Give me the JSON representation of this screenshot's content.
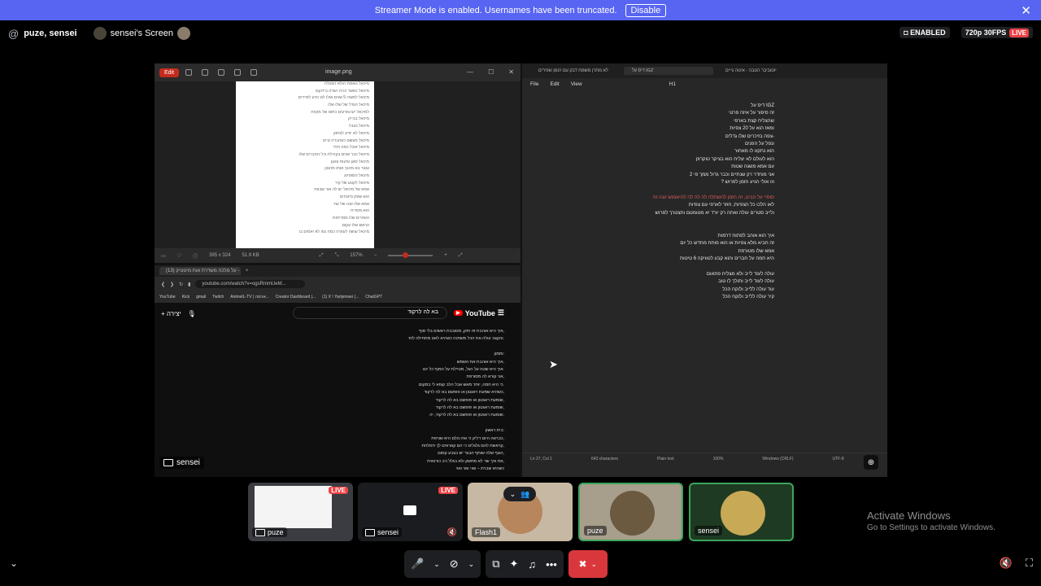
{
  "banner": {
    "message": "Streamer Mode is enabled. Usernames have been truncated.",
    "disable_label": "Disable",
    "close_glyph": "✕"
  },
  "topbar": {
    "users": "puze, sensei",
    "stream_title": "sensei's Screen",
    "enabled_label": "ENABLED",
    "quality_label": "720p 30FPS",
    "live_label": "LIVE"
  },
  "image_viewer": {
    "edit_label": "Edit",
    "file_name": "image.png",
    "footer_dims": "395 x 324",
    "footer_size": "51.9 KB",
    "zoom_level": "157%",
    "doc_lines": [
      "מיכאל נואמת הולא הוזגלדו",
      "מיכאל כאשר ככיה הגדה בידוקם",
      "מיכאל לפשרו 5 שנים אולו לא רגיע לפרדים",
      "מיכאל הגדל של שלו שלו",
      "למיכאל יש נפרעים כתוא של מקיוח",
      "מיכאל בבייק",
      "מיכאל נונבל",
      "מיכאל לא יודע לצחוק",
      "מיכאל מעשם כאהבדה טייט",
      "מיכאל אוכל כמה חזיר",
      "מיכאל כבר שנים בקהילה וכל החברים שלו",
      "מיכאל סוגן טיטות ונגען",
      "עטור בא מהנך אותו מהטון",
      "מיכאל המוסינג",
      "מיכאל לקטע של קיר",
      "אמא של מיכאל יש לה אור שבוות",
      "הוא שותן מיונתים",
      "אמא שלו זונה של עוד",
      "הוא מסריח",
      "השיניים שלו מסריחות",
      "הראש שלו עקום",
      "מיכאל עושה לעוזרה כמה נמו לא יאמים בו"
    ]
  },
  "browser": {
    "tab_title": "(13) על מלכה משדרת אות מיטטיק -",
    "url": "youtube.com/watch?v=ogsRmmUeM...",
    "bookmarks": [
      "YouTube",
      "Kick",
      "gmail",
      "Twitch",
      "AnimeIL-TV | אנימה...",
      "Creator Dashboard |...",
      "(1) X \\ Yarijemsei (...",
      "ChatGPT"
    ],
    "search_query": "בא לה לרקוד",
    "yt_brand": "YouTube",
    "create_label": "יצירה",
    "lyrics": [
      "איך היא אוהבת זה חזק, מסובבת ראשים בלי סוף,",
      "והקצב עולה את הכל משתנה כשהיא לאט מתחילה לזוז.",
      "",
      "פזמון:",
      "איך היא אוהבת את השמש,",
      "איך היא שטה על הגל, מטיילת על המוף כל יום.",
      "אני קורא לה מסורפת,",
      "כי היא חמה, יותר מאש אבל הלב קופא לי במקום.",
      "כשהיא שמעת ראגטון או פופשם בא לה לרקוד,",
      "שומעת ראגטון או פופשם בא לה לרקוד,",
      "שומעת ראגטון או פופשם בא לה לרקוד,",
      "שומעת ראגטון או פופשם בא לה לרקוד, יה.",
      "",
      "בית ראשון:",
      "כבראה היום דליק כי את כולם היא שורפת,",
      "קראשת להם גלגלים כי הם קאראים לך תפלחת,",
      "הגוף שלה שותף הבגד יש בצבע קסום,",
      "את איך שר לא מתשק ולא בגלל ניב כורנאית,",
      "כשהיא שברת – ואוי ואוי ואוי"
    ]
  },
  "notepad": {
    "tabs": [
      "לא מתרן משמח דבק עם הומן שפירים",
      "דיס על IGZ",
      "יוטוביבר הטבה - אינוה גייים"
    ],
    "menu": [
      "File",
      "Edit",
      "View"
    ],
    "heading_label": "H1",
    "lines": [
      "דיס על IGZ",
      "זה סיפור על איזה פרטי",
      "שהצליח קצת בארפי",
      "ומאז הוא על 20 צפיות",
      "צפה בזיכרים שלו גדלים-",
      "ונפל על הפנים",
      "הוא נתקע לו מאחור",
      "הוא לעולם לא יצליח הוא בציקר טוקרוזן",
      "עם אמא משגה שטות",
      "אני מוחדר רק שנתיים וכבר גדול ממך פי 2",
      "? וזו אולי הגיע הזמן לפרוש",
      "",
      "סוסיי על הביט, זה הזמן להשתלה לה לה לה להיאמוש זונה זה",
      "לאו הלכו כל הצפיות, חוזר לארפי עם צפיות",
      "ולייב סטרים עולה ואתה רק יורד יא מטומטם ותצטרך לפרוש",
      "",
      "",
      "איך הוא אוהב לפתוח דרמות",
      "זה חביא מלא צפיות או הוא פותח מחדש כל יום",
      "אמא שלו מטורפת",
      "היא חמה על חברים והוא קבע לטוויקה 6 טיטות",
      "",
      "עולה לעוד לייב ולא מצליח פתאום",
      "עולה לעוד לייב ותולך לו טוב",
      "עוד עולה ללייב ולוקח הכל",
      "קיר עולה ללייב ולוקח הכל"
    ],
    "highlight_line": 12,
    "status": [
      "Ln 27, Col 1",
      "643 characters",
      "Plain text",
      "100%",
      "Windows (CRLF)",
      "UTF-8"
    ]
  },
  "stage_name_tag": "sensei",
  "tiles": [
    {
      "name": "puze",
      "live": "LIVE"
    },
    {
      "name": "sensei",
      "live": "LIVE"
    },
    {
      "name": "Flash1",
      "live": ""
    },
    {
      "name": "puze",
      "live": ""
    },
    {
      "name": "sensei",
      "live": ""
    }
  ],
  "activate": {
    "title": "Activate Windows",
    "subtitle": "Go to Settings to activate Windows."
  },
  "colors": {
    "banner": "#5865f2",
    "live": "#ed4245",
    "speaking_border": "#3ba55d",
    "hangup": "#da373c"
  }
}
